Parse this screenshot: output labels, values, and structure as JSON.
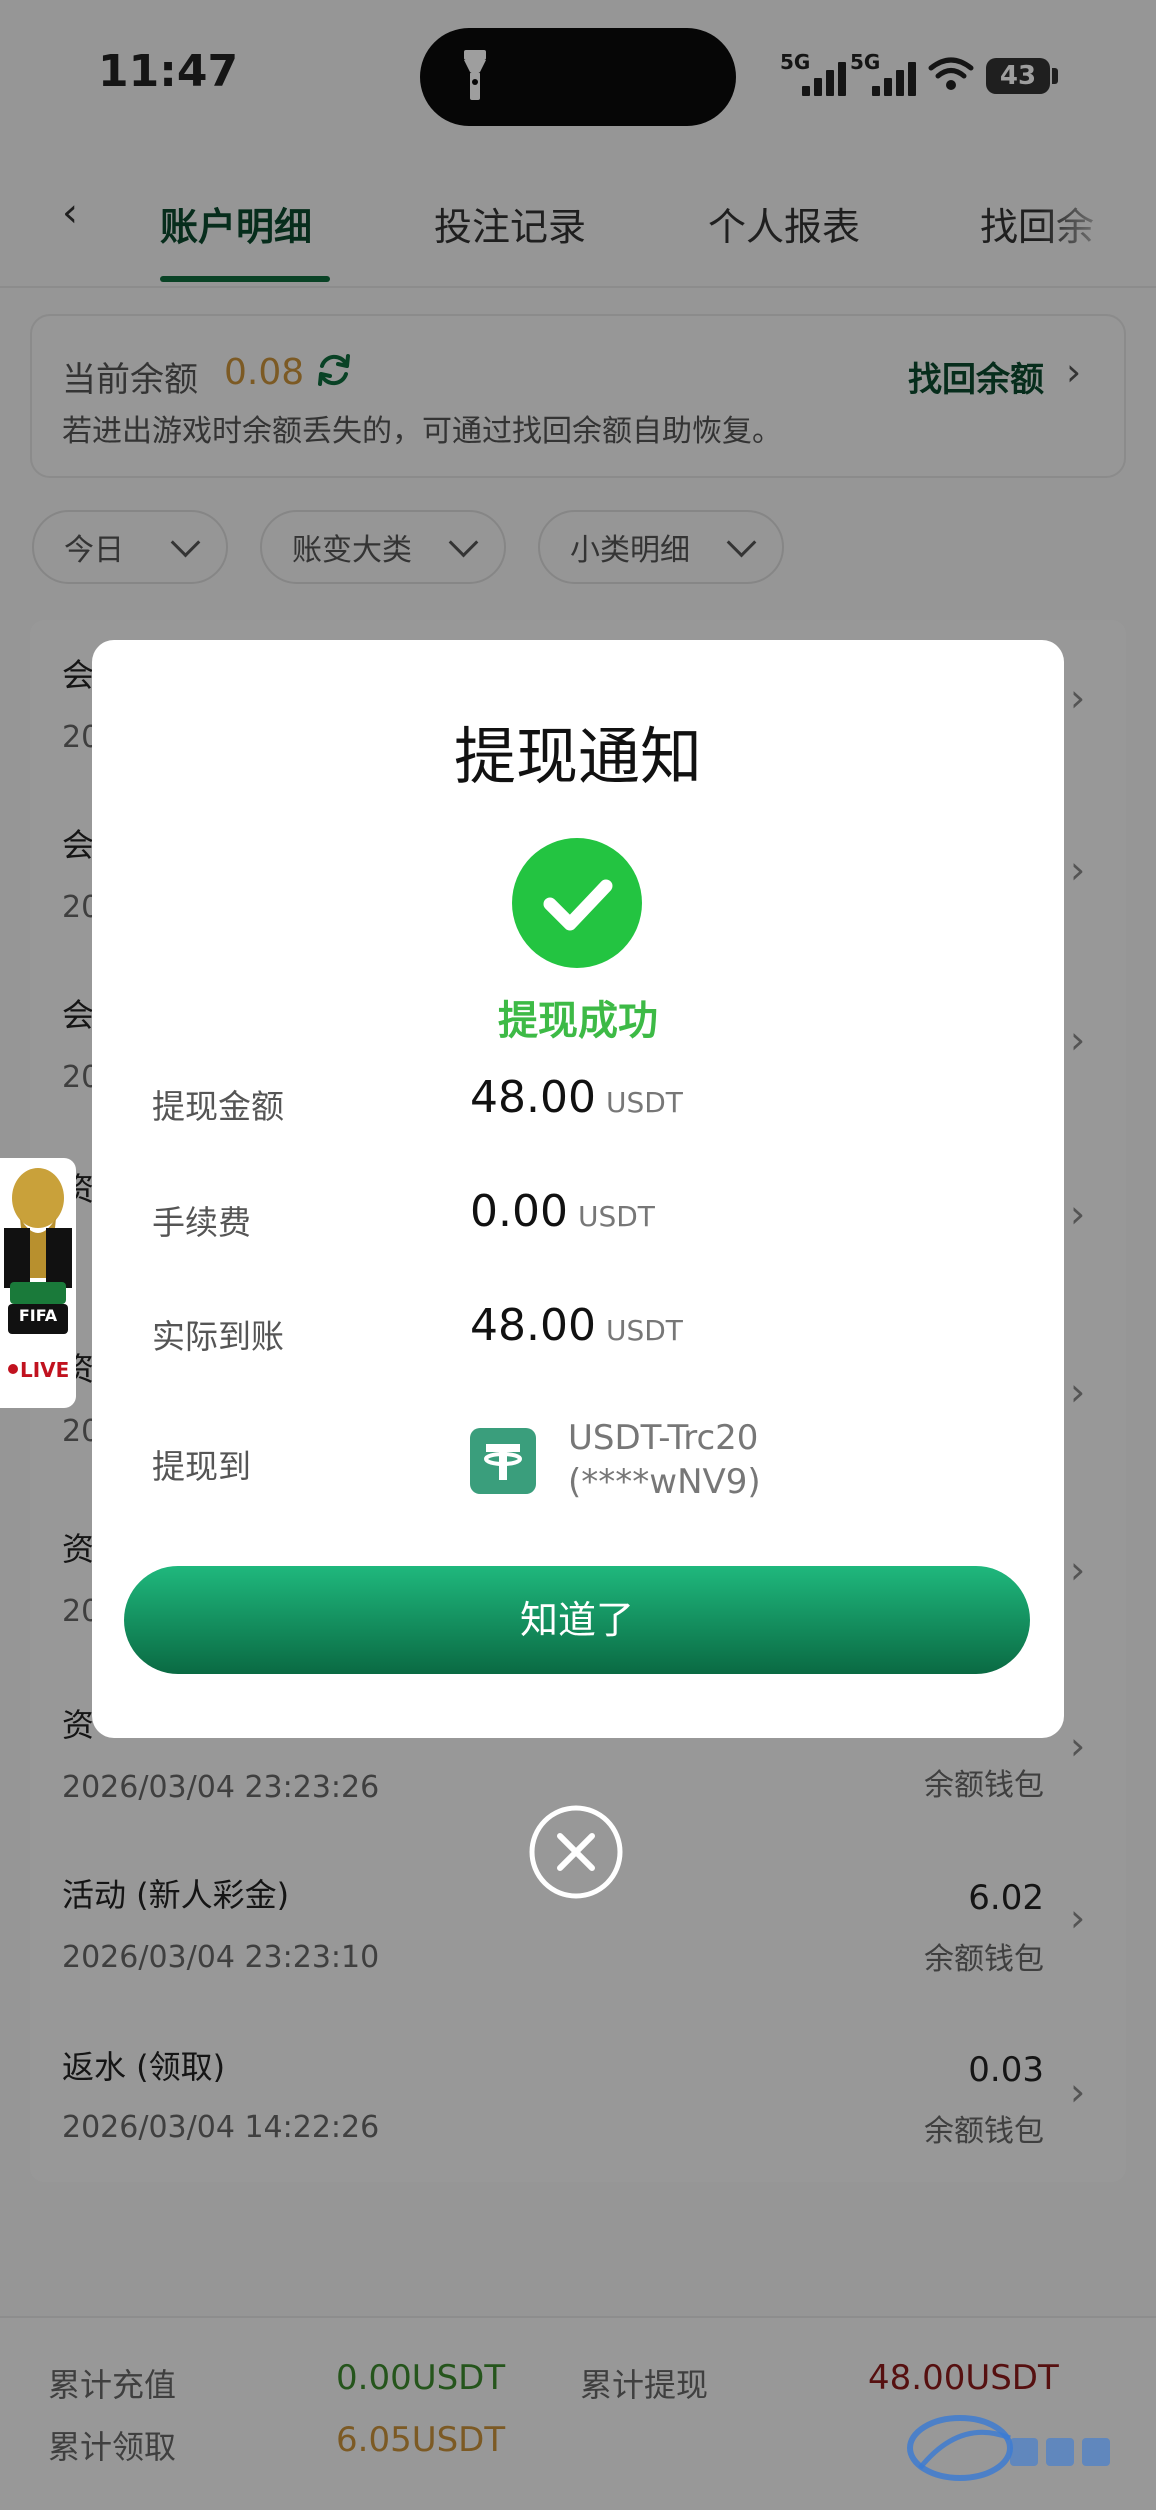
{
  "status_bar": {
    "time": "11:47",
    "signal_1": "5G",
    "signal_2": "5G",
    "battery": "43"
  },
  "tabs": [
    {
      "label": "账户明细",
      "active": true
    },
    {
      "label": "投注记录",
      "active": false
    },
    {
      "label": "个人报表",
      "active": false
    },
    {
      "label": "找回余",
      "active": false
    }
  ],
  "balance": {
    "label": "当前余额",
    "value": "0.08",
    "recover_label": "找回余额",
    "hint": "若进出游戏时余额丢失的，可通过找回余额自助恢复。"
  },
  "filters": [
    {
      "label": "今日"
    },
    {
      "label": "账变大类"
    },
    {
      "label": "小类明细"
    }
  ],
  "list": [
    {
      "title": "会",
      "time": "20",
      "amount": "",
      "wallet": ""
    },
    {
      "title": "会",
      "time": "20",
      "amount": "",
      "wallet": ""
    },
    {
      "title": "会",
      "time": "20",
      "amount": "",
      "wallet": ""
    },
    {
      "title": "资",
      "time": "",
      "amount": "",
      "wallet": ""
    },
    {
      "title": "资",
      "time": "20",
      "amount": "",
      "wallet": ""
    },
    {
      "title": "资",
      "time": "20",
      "amount": "",
      "wallet": ""
    },
    {
      "title": "资",
      "time": "2026/03/04 23:23:26",
      "amount": "",
      "wallet": "余额钱包"
    },
    {
      "title": "活动 (新人彩金)",
      "time": "2026/03/04 23:23:10",
      "amount": "6.02",
      "wallet": "余额钱包"
    },
    {
      "title": "返水 (领取)",
      "time": "2026/03/04 14:22:26",
      "amount": "0.03",
      "wallet": "余额钱包"
    }
  ],
  "footer": {
    "total_recharge_label": "累计充值",
    "total_recharge_value": "0.00USDT",
    "total_withdraw_label": "累计提现",
    "total_withdraw_value": "48.00USDT",
    "total_claim_label": "累计领取",
    "total_claim_value": "6.05USDT",
    "colors": {
      "recharge": "#3d8a2e",
      "withdraw": "#8b1a1a",
      "claim": "#c8913a"
    }
  },
  "fifa_widget": {
    "brand": "FIFA",
    "live": "LIVE"
  },
  "modal": {
    "title": "提现通知",
    "status": "提现成功",
    "rows": [
      {
        "label": "提现金额",
        "value": "48.00",
        "unit": "USDT"
      },
      {
        "label": "手续费",
        "value": "0.00",
        "unit": "USDT"
      },
      {
        "label": "实际到账",
        "value": "48.00",
        "unit": "USDT"
      }
    ],
    "dest_label": "提现到",
    "dest_channel": "USDT-Trc20",
    "dest_account": "(****wNV9)",
    "button": "知道了",
    "icons": {
      "status": "check-icon",
      "channel": "tether-icon",
      "close": "close-icon"
    },
    "accent_color": "#23c441"
  }
}
